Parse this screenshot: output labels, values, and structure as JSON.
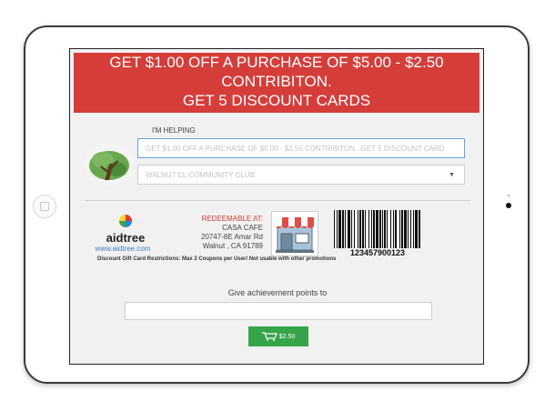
{
  "banner": {
    "line1": "GET $1.00 OFF A PURCHASE OF $5.00 - $2.50",
    "line2": "CONTRIBITON.",
    "line3": "GET 5 DISCOUNT CARDS"
  },
  "form": {
    "helping_label": "I'M HELPING",
    "title_value": "GET $1.00 OFF A PURCHASE OF $5.00 - $2.50 CONTRIBITON.. GET 5 DISCOUNT CARD",
    "community_selected": "WALNUT EL COMMUNITY CLUB"
  },
  "brand": {
    "name": "aidtree",
    "url": "www.aidtree.com",
    "logo_colors": [
      "#e53935",
      "#43a047",
      "#1e88e5",
      "#fdd835"
    ]
  },
  "redeem": {
    "label": "REDEEMABLE AT:",
    "store_name": "CASA CAFE",
    "address_line1": "20747-8E Amar Rd",
    "address_line2": "Walnut , CA 91789"
  },
  "barcode": {
    "number": "123457900123"
  },
  "restrictions": "Discount Gift Card Restrictions: Max 2 Coupons per User/ Not usable with other promotions",
  "achievement": {
    "label": "Give achievement points to",
    "value": ""
  },
  "cart_button": {
    "label": "$2.50",
    "icon": "cart-icon"
  },
  "colors": {
    "banner": "#d43d3a",
    "button": "#36a54a",
    "link": "#3e7fc7",
    "focus_border": "#66a3e0"
  }
}
